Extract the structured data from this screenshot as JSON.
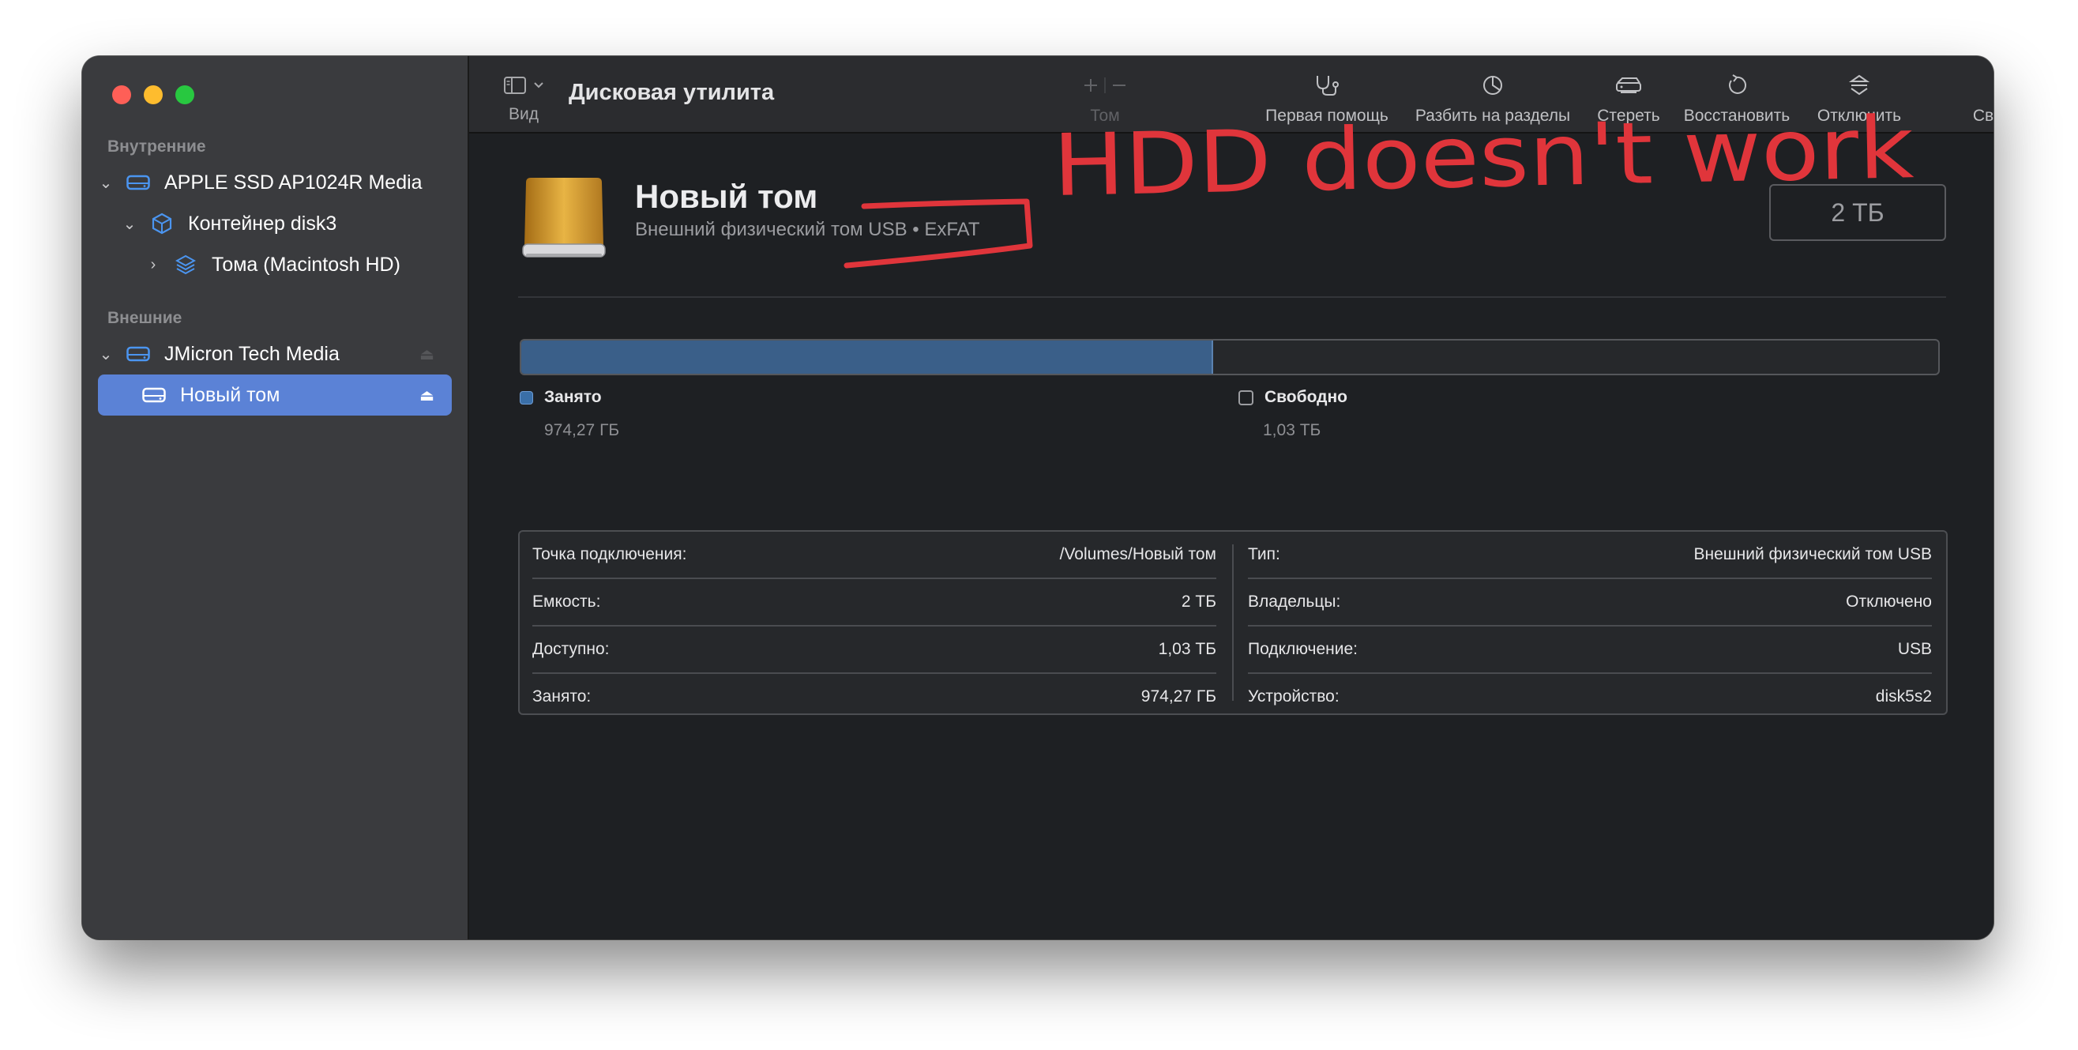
{
  "sidebar": {
    "sections": {
      "internal": "Внутренние",
      "external": "Внешние"
    },
    "items": [
      {
        "label": "APPLE SSD AP1024R Media",
        "icon": "hard-drive-icon"
      },
      {
        "label": "Контейнер disk3",
        "icon": "container-cube-icon"
      },
      {
        "label": "Тома (Macintosh HD)",
        "icon": "volumes-stack-icon"
      },
      {
        "label": "JMicron Tech Media",
        "icon": "hard-drive-icon"
      },
      {
        "label": "Новый том",
        "icon": "hard-drive-icon",
        "selected": true
      }
    ]
  },
  "toolbar": {
    "view_label": "Вид",
    "title": "Дисковая утилита",
    "volume_label": "Том",
    "first_aid": "Первая помощь",
    "partition": "Разбить на разделы",
    "erase": "Стереть",
    "restore": "Восстановить",
    "unmount": "Отключить",
    "info": "Свойства"
  },
  "volume": {
    "name": "Новый том",
    "subtitle": "Внешний физический том USB • ExFAT",
    "capacity": "2 ТБ",
    "used_fraction": 0.487
  },
  "usage": {
    "used_label": "Занято",
    "used_value": "974,27 ГБ",
    "free_label": "Свободно",
    "free_value": "1,03 ТБ"
  },
  "info": {
    "left": [
      {
        "key": "Точка подключения:",
        "value": "/Volumes/Новый том"
      },
      {
        "key": "Емкость:",
        "value": "2 ТБ"
      },
      {
        "key": "Доступно:",
        "value": "1,03 ТБ"
      },
      {
        "key": "Занято:",
        "value": "974,27 ГБ"
      }
    ],
    "right": [
      {
        "key": "Тип:",
        "value": "Внешний физический том USB"
      },
      {
        "key": "Владельцы:",
        "value": "Отключено"
      },
      {
        "key": "Подключение:",
        "value": "USB"
      },
      {
        "key": "Устройство:",
        "value": "disk5s2"
      }
    ]
  },
  "annotation": {
    "text": "HDD doesn't work",
    "color": "#e0353b"
  },
  "colors": {
    "accent": "#5b82d6",
    "used_bar": "#3a5f89"
  }
}
